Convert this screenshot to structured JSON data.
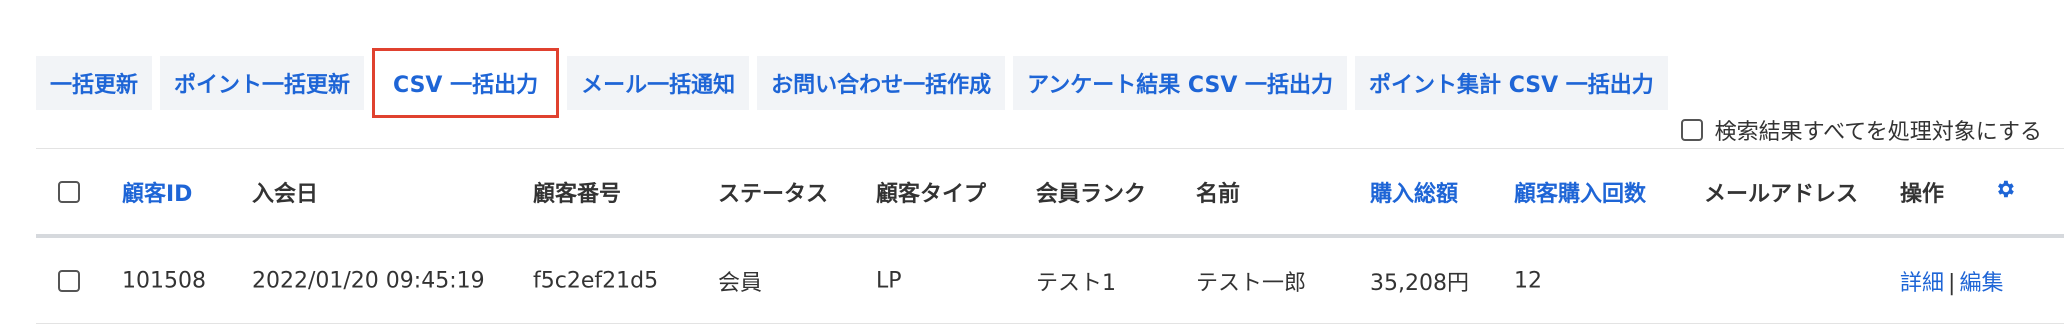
{
  "toolbar": {
    "buttons": [
      {
        "label": "一括更新"
      },
      {
        "label": "ポイント一括更新"
      },
      {
        "label": "CSV 一括出力"
      },
      {
        "label": "メール一括通知"
      },
      {
        "label": "お問い合わせ一括作成"
      },
      {
        "label": "アンケート結果 CSV 一括出力"
      },
      {
        "label": "ポイント集計 CSV 一括出力"
      }
    ]
  },
  "all_results_checkbox": {
    "label": "検索結果すべてを処理対象にする",
    "checked": false
  },
  "table": {
    "columns": [
      {
        "label": "顧客ID",
        "sortable": true
      },
      {
        "label": "入会日",
        "sortable": false
      },
      {
        "label": "顧客番号",
        "sortable": false
      },
      {
        "label": "ステータス",
        "sortable": false
      },
      {
        "label": "顧客タイプ",
        "sortable": false
      },
      {
        "label": "会員ランク",
        "sortable": false
      },
      {
        "label": "名前",
        "sortable": false
      },
      {
        "label": "購入総額",
        "sortable": true
      },
      {
        "label": "顧客購入回数",
        "sortable": true
      },
      {
        "label": "メールアドレス",
        "sortable": false
      },
      {
        "label": "操作",
        "sortable": false
      }
    ],
    "settings_icon": "gear-icon",
    "rows": [
      {
        "customer_id": "101508",
        "joined": "2022/01/20 09:45:19",
        "customer_number": "f5c2ef21d5",
        "status": "会員",
        "customer_type": "LP",
        "rank": "テスト1",
        "name": "テスト一郎",
        "total": "35,208円",
        "purchase_count": "12",
        "email": "",
        "actions": {
          "detail": "詳細",
          "separator": "|",
          "edit": "編集"
        }
      }
    ]
  },
  "colors": {
    "accent": "#1e65d6",
    "highlight_border": "#e0412f",
    "button_bg": "#f2f4f7"
  }
}
